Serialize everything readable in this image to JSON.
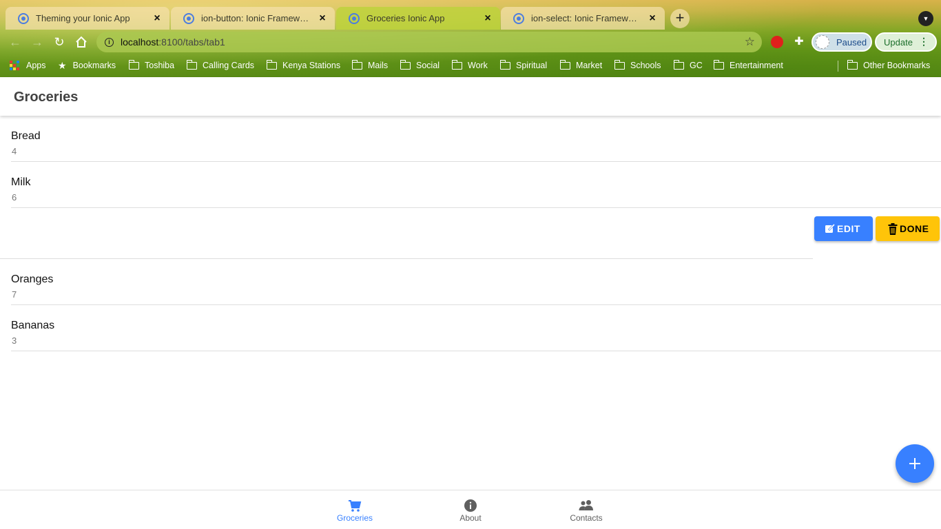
{
  "browser": {
    "tabs": [
      {
        "title": "Theming your Ionic App",
        "active": false
      },
      {
        "title": "ion-button: Ionic Framework API Docs",
        "active": false
      },
      {
        "title": "Groceries Ionic App",
        "active": true
      },
      {
        "title": "ion-select: Ionic Framework API Docs",
        "active": false
      }
    ],
    "new_tab": "+",
    "address": {
      "host": "localhost",
      "path": ":8100/tabs/tab1"
    },
    "profile_status": "Paused",
    "update_label": "Update",
    "bookmarks": [
      {
        "label": "Apps",
        "type": "apps"
      },
      {
        "label": "Bookmarks",
        "type": "star"
      },
      {
        "label": "Toshiba",
        "type": "folder"
      },
      {
        "label": "Calling Cards",
        "type": "folder"
      },
      {
        "label": "Kenya Stations",
        "type": "folder"
      },
      {
        "label": "Mails",
        "type": "folder"
      },
      {
        "label": "Social",
        "type": "folder"
      },
      {
        "label": "Work",
        "type": "folder"
      },
      {
        "label": "Spiritual",
        "type": "folder"
      },
      {
        "label": "Market",
        "type": "folder"
      },
      {
        "label": "Schools",
        "type": "folder"
      },
      {
        "label": "GC",
        "type": "folder"
      },
      {
        "label": "Entertainment",
        "type": "folder"
      }
    ],
    "other_bookmarks": "Other Bookmarks"
  },
  "app": {
    "title": "Groceries",
    "items": [
      {
        "name": "Bread",
        "quantity": "4"
      },
      {
        "name": "Milk",
        "quantity": "6"
      },
      {
        "name": "Oranges",
        "quantity": "7"
      },
      {
        "name": "Bananas",
        "quantity": "3"
      }
    ],
    "item_options": {
      "edit_label": "EDIT",
      "done_label": "DONE"
    },
    "fab_icon": "add-icon",
    "tabbar": [
      {
        "label": "Groceries",
        "icon": "cart-icon",
        "selected": true
      },
      {
        "label": "About",
        "icon": "info-circle-icon",
        "selected": false
      },
      {
        "label": "Contacts",
        "icon": "people-icon",
        "selected": false
      }
    ]
  },
  "colors": {
    "primary": "#3880ff",
    "warning": "#ffc409",
    "title_text": "#424242",
    "tab_inactive": "#5f5f5f"
  }
}
